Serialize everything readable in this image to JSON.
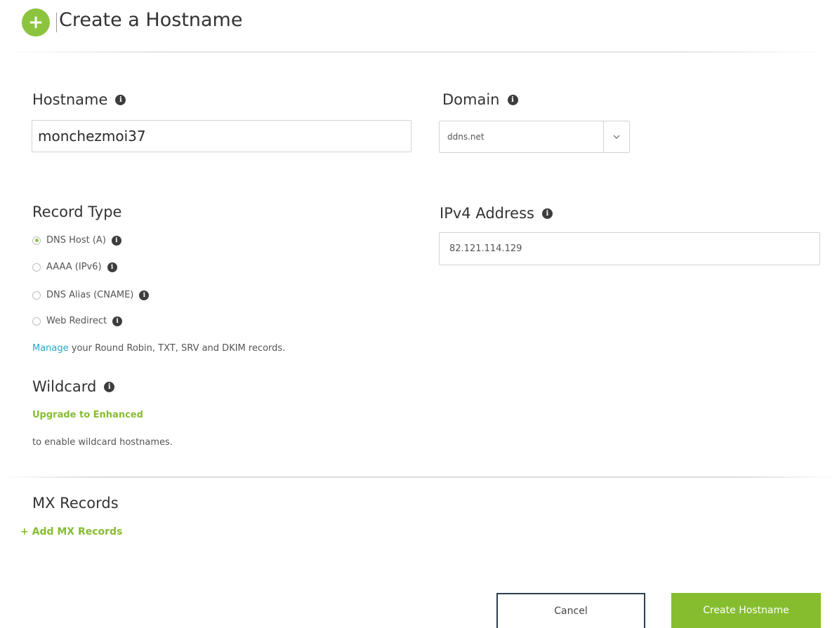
{
  "header": {
    "title": "Create a Hostname",
    "icon": "plus-circle-icon",
    "icon_glyph": "+",
    "accent_color": "#8cc43f"
  },
  "hostname": {
    "label": "Hostname",
    "value": "monchezmoi37"
  },
  "domain": {
    "label": "Domain",
    "selected": "ddns.net"
  },
  "record_type": {
    "label": "Record Type",
    "options": [
      {
        "label": "DNS Host (A)",
        "checked": true
      },
      {
        "label": "AAAA (IPv6)",
        "checked": false
      },
      {
        "label": "DNS Alias (CNAME)",
        "checked": false
      },
      {
        "label": "Web Redirect",
        "checked": false
      }
    ],
    "manage_link": "Manage",
    "manage_text": " your Round Robin, TXT, SRV and DKIM records."
  },
  "ipv4": {
    "label": "IPv4 Address",
    "value": "82.121.114.129"
  },
  "wildcard": {
    "label": "Wildcard",
    "upgrade_link": "Upgrade to Enhanced",
    "note": "to enable wildcard hostnames."
  },
  "mx": {
    "label": "MX Records",
    "add_link": "+ Add MX Records"
  },
  "actions": {
    "cancel": "Cancel",
    "create": "Create Hostname"
  }
}
